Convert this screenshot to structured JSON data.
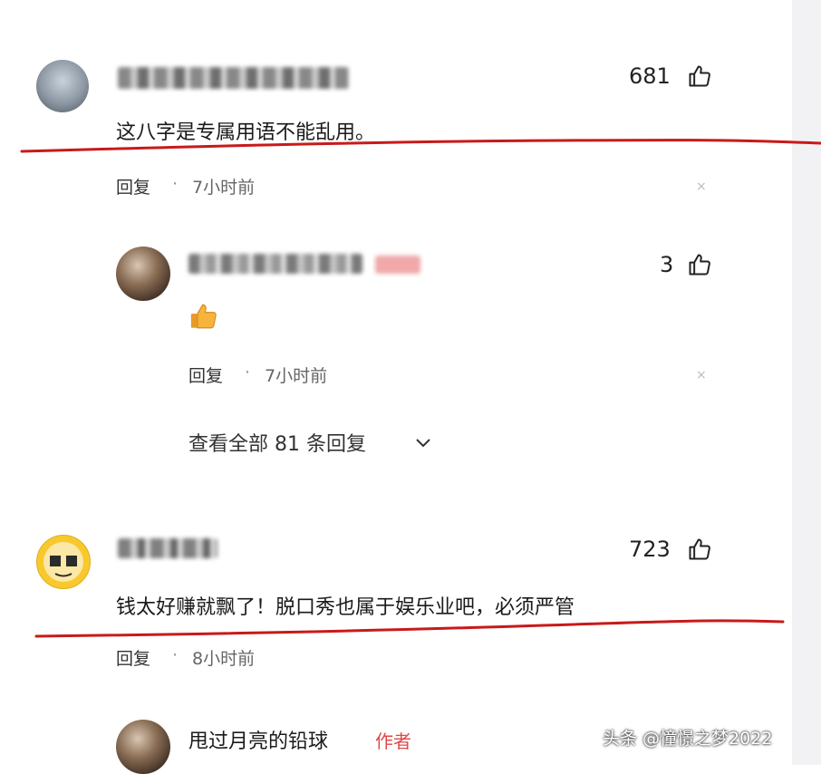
{
  "comments": [
    {
      "likes": "681",
      "text": "这八字是专属用语不能乱用。",
      "reply_label": "回复",
      "separator": "·",
      "time": "7小时前"
    },
    {
      "likes": "723",
      "text": "钱太好赚就飘了！脱口秀也属于娱乐业吧，必须严管",
      "reply_label": "回复",
      "separator": "·",
      "time": "8小时前"
    }
  ],
  "sub_reply": {
    "likes": "3",
    "reply_label": "回复",
    "separator": "·",
    "time": "7小时前"
  },
  "view_all_replies": "查看全部 81 条回复",
  "author_reply": {
    "username": "甩过月亮的铅球",
    "badge": "作者"
  },
  "close_glyph": "×",
  "watermark": "头条 @憧憬之梦2022",
  "colors": {
    "annotation_red": "#c81a1a",
    "author_badge": "#e04848"
  }
}
